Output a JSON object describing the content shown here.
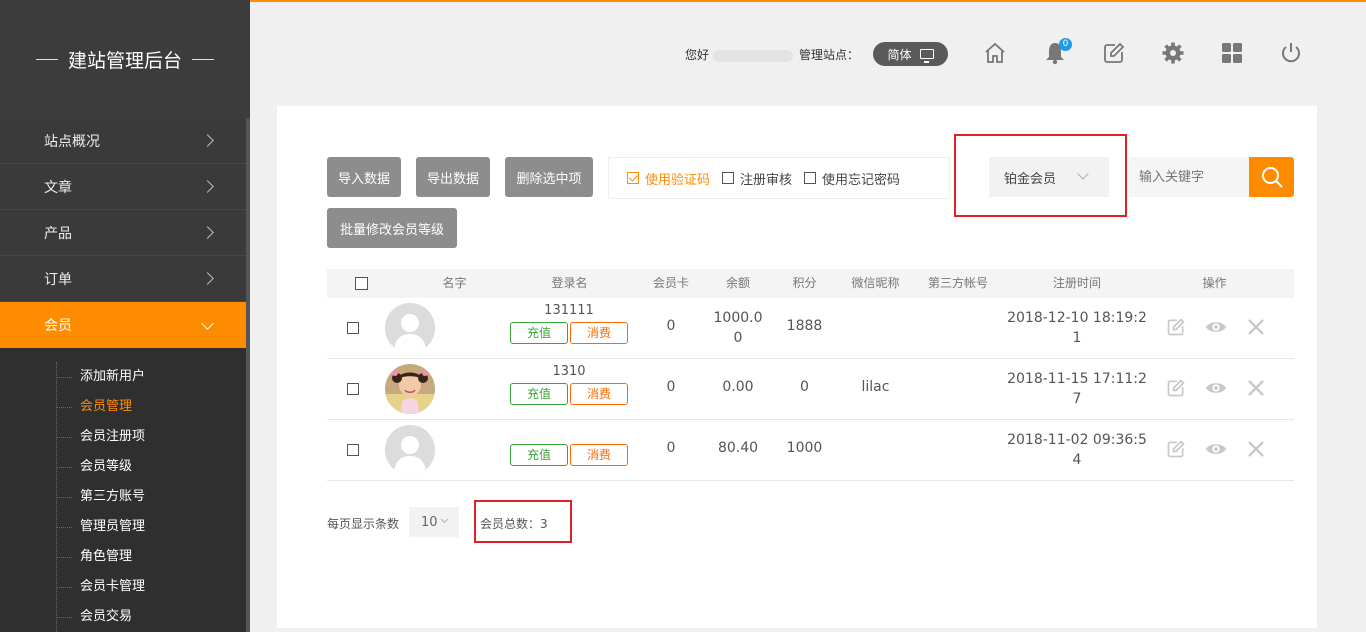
{
  "sidebar": {
    "brand": "建站管理后台",
    "items": [
      {
        "label": "站点概况"
      },
      {
        "label": "文章"
      },
      {
        "label": "产品"
      },
      {
        "label": "订单"
      },
      {
        "label": "会员"
      }
    ],
    "subitems": [
      {
        "label": "添加新用户"
      },
      {
        "label": "会员管理"
      },
      {
        "label": "会员注册项"
      },
      {
        "label": "会员等级"
      },
      {
        "label": "第三方账号"
      },
      {
        "label": "管理员管理"
      },
      {
        "label": "角色管理"
      },
      {
        "label": "会员卡管理"
      },
      {
        "label": "会员交易"
      }
    ]
  },
  "header": {
    "greeting": "您好",
    "site_label": "管理站点：",
    "language": "简体",
    "notification_count": "0"
  },
  "toolbar": {
    "import": "导入数据",
    "export": "导出数据",
    "delete_selected": "删除选中项",
    "batch_level": "批量修改会员等级",
    "opt_captcha": "使用验证码",
    "opt_review": "注册审核",
    "opt_forgot": "使用忘记密码",
    "level_select": "铂金会员",
    "search_placeholder": "输入关键字"
  },
  "table": {
    "headers": {
      "name": "名字",
      "login": "登录名",
      "card": "会员卡",
      "balance": "余额",
      "points": "积分",
      "wechat": "微信昵称",
      "thirdparty": "第三方帐号",
      "regtime": "注册时间",
      "ops": "操作"
    },
    "recharge_label": "充值",
    "consume_label": "消费",
    "rows": [
      {
        "login": "131111",
        "card": "0",
        "balance_l1": "1000.0",
        "balance_l2": "0",
        "points": "1888",
        "wechat": "",
        "time_l1": "2018-12-10 18:19:2",
        "time_l2": "1"
      },
      {
        "login": "1310",
        "card": "0",
        "balance_l1": "0.00",
        "balance_l2": "",
        "points": "0",
        "wechat": "lilac",
        "time_l1": "2018-11-15 17:11:2",
        "time_l2": "7"
      },
      {
        "login": "",
        "card": "0",
        "balance_l1": "80.40",
        "balance_l2": "",
        "points": "1000",
        "wechat": "",
        "time_l1": "2018-11-02 09:36:5",
        "time_l2": "4"
      }
    ]
  },
  "footer": {
    "per_page_label": "每页显示条数",
    "per_page_value": "10",
    "total_label": "会员总数：3"
  },
  "colors": {
    "accent": "#ff8c00",
    "highlight_box": "#e0202a",
    "sidebar_bg": "#3a3a3a"
  }
}
